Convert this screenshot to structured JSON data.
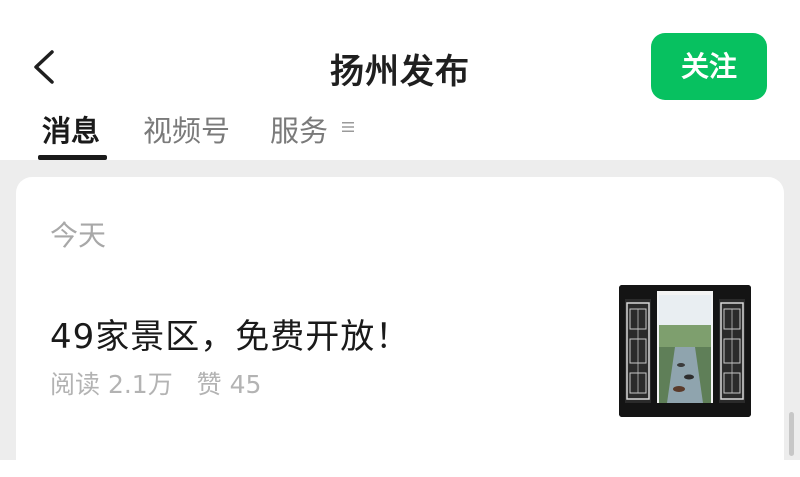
{
  "header": {
    "title": "扬州发布",
    "follow_label": "关注"
  },
  "tabs": [
    {
      "label": "消息",
      "active": true
    },
    {
      "label": "视频号",
      "active": false
    },
    {
      "label": "服务",
      "active": false
    }
  ],
  "feed": {
    "date_label": "今天",
    "article": {
      "title": "49家景区，免费开放！",
      "reads": "阅读 2.1万",
      "likes": "赞 45"
    }
  },
  "colors": {
    "accent": "#07c160",
    "background": "#ededed"
  },
  "icons": {
    "back": "chevron-left-icon",
    "menu": "menu-lines-icon"
  }
}
